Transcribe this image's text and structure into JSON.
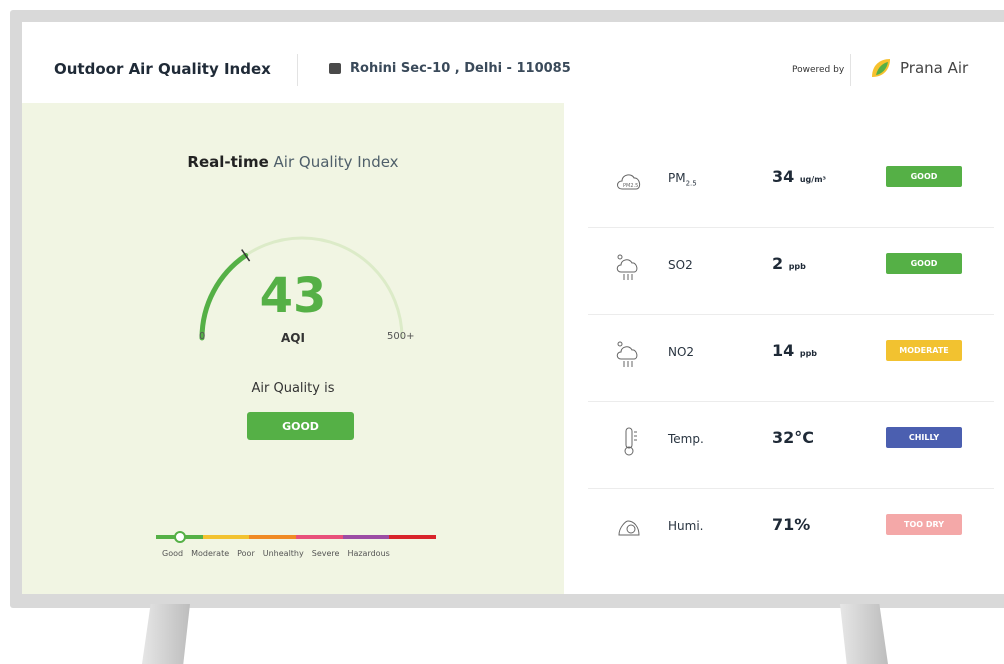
{
  "header": {
    "title": "Outdoor Air Quality Index",
    "location": "Rohini Sec-10 , Delhi - 110085",
    "powered_by": "Powered by",
    "brand": "Prana Air"
  },
  "realtime": {
    "title_strong": "Real-time",
    "title_light": "Air Quality Index",
    "aqi_value": "43",
    "aqi_label": "AQI",
    "gauge_min": "0",
    "gauge_max": "500+",
    "air_quality_is": "Air Quality is",
    "status": "GOOD",
    "gauge_fraction": 0.086
  },
  "scale": {
    "labels": [
      "Good",
      "Moderate",
      "Poor",
      "Unhealthy",
      "Severe",
      "Hazardous"
    ],
    "colors": [
      "#55b046",
      "#f2c230",
      "#f08a24",
      "#e8507a",
      "#9c4ca4",
      "#d8232a"
    ]
  },
  "metrics": [
    {
      "name": "PM",
      "sub": "2.5",
      "value": "34",
      "unit": "ug/m³",
      "badge": "GOOD",
      "color": "#55b046",
      "icon": "pm25-cloud-icon"
    },
    {
      "name": "SO2",
      "sub": "",
      "value": "2",
      "unit": "ppb",
      "badge": "GOOD",
      "color": "#55b046",
      "icon": "so2-cloud-icon"
    },
    {
      "name": "NO2",
      "sub": "",
      "value": "14",
      "unit": "ppb",
      "badge": "MODERATE",
      "color": "#f2c230",
      "icon": "no2-cloud-icon"
    },
    {
      "name": "Temp.",
      "sub": "",
      "value": "32",
      "unit": "°C",
      "badge": "CHILLY",
      "color": "#4b5fb0",
      "icon": "thermometer-icon"
    },
    {
      "name": "Humi.",
      "sub": "",
      "value": "71",
      "unit": "%",
      "badge": "TOO DRY",
      "color": "#f4a8a8",
      "icon": "humidity-icon"
    }
  ]
}
